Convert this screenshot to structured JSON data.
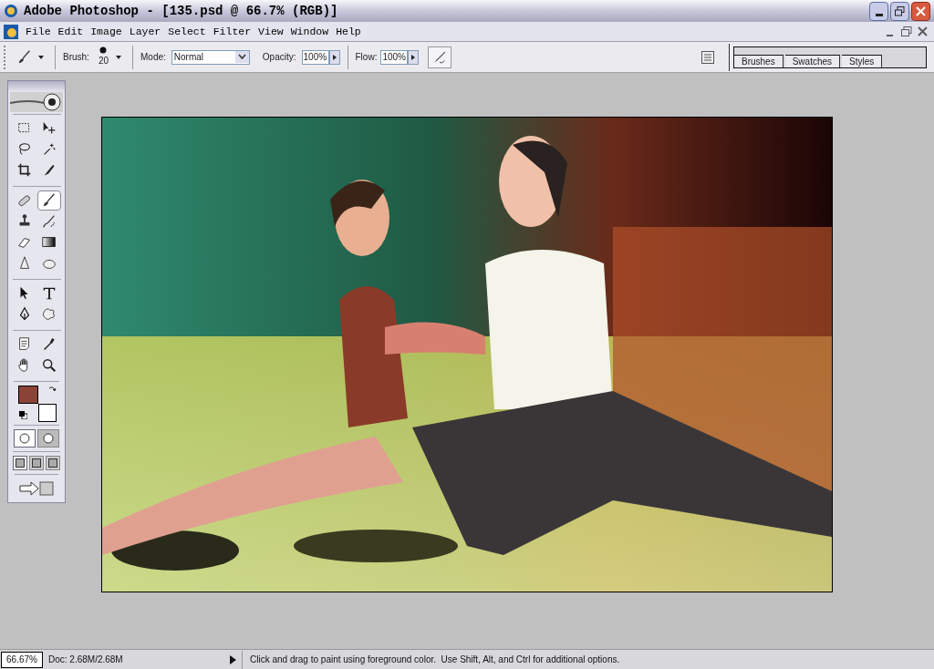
{
  "window": {
    "title": "Adobe Photoshop - [135.psd @ 66.7% (RGB)]"
  },
  "menu": [
    "File",
    "Edit",
    "Image",
    "Layer",
    "Select",
    "Filter",
    "View",
    "Window",
    "Help"
  ],
  "options": {
    "brush_label": "Brush:",
    "brush_size": "20",
    "mode_label": "Mode:",
    "mode": "Normal",
    "opacity_label": "Opacity:",
    "opacity": "100%",
    "flow_label": "Flow:",
    "flow": "100%"
  },
  "palette_tabs": [
    "Brushes",
    "Swatches",
    "Styles"
  ],
  "toolbox": {
    "groups": [
      [
        {
          "kind": "marquee",
          "selected": false
        },
        {
          "kind": "move",
          "selected": false
        },
        {
          "kind": "lasso",
          "selected": false
        },
        {
          "kind": "wand",
          "selected": false
        },
        {
          "kind": "crop",
          "selected": false
        },
        {
          "kind": "slice",
          "selected": false
        }
      ],
      [
        {
          "kind": "heal",
          "selected": false
        },
        {
          "kind": "brush",
          "selected": true
        },
        {
          "kind": "stamp",
          "selected": false
        },
        {
          "kind": "history",
          "selected": false
        },
        {
          "kind": "eraser",
          "selected": false
        },
        {
          "kind": "gradient",
          "selected": false
        },
        {
          "kind": "blur",
          "selected": false
        },
        {
          "kind": "dodge",
          "selected": false
        }
      ],
      [
        {
          "kind": "path",
          "selected": false
        },
        {
          "kind": "type",
          "selected": false
        },
        {
          "kind": "pen",
          "selected": false
        },
        {
          "kind": "shape",
          "selected": false
        }
      ],
      [
        {
          "kind": "notes",
          "selected": false
        },
        {
          "kind": "eyedropper",
          "selected": false
        },
        {
          "kind": "hand",
          "selected": false
        },
        {
          "kind": "zoom",
          "selected": false
        }
      ]
    ],
    "foreground": {
      "color": "#8b4338"
    },
    "background": {
      "color": "#ffffff"
    },
    "mask_modes": [
      {
        "selected": true
      },
      {
        "selected": false
      }
    ],
    "screen_modes": [
      {
        "selected": true
      },
      {
        "selected": false
      },
      {
        "selected": false
      }
    ]
  },
  "status": {
    "zoom": "66.67%",
    "doc": "Doc: 2.68M/2.68M",
    "message": "Click and drag to paint using foreground color.  Use Shift, Alt, and Ctrl for additional options."
  }
}
